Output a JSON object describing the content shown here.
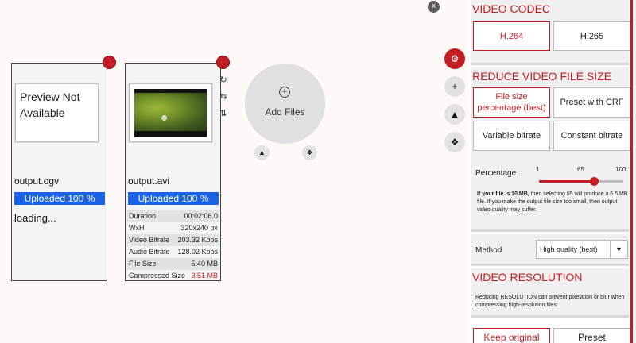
{
  "close_label": "x",
  "files": [
    {
      "preview_text": "Preview Not Available",
      "name": "output.ogv",
      "progress": "Uploaded 100 %",
      "progress_fraction": 1.0,
      "status": "loading..."
    },
    {
      "name": "output.avi",
      "progress": "Uploaded 100 %",
      "progress_fraction": 1.0,
      "stats": [
        {
          "k": "Duration",
          "v": "00:02:06.0"
        },
        {
          "k": "WxH",
          "v": "320x240 px"
        },
        {
          "k": "Video Bitrate",
          "v": "203.32 Kbps"
        },
        {
          "k": "Audio Bitrate",
          "v": "128.02 Kbps"
        },
        {
          "k": "File Size",
          "v": "5.40 MB"
        },
        {
          "k": "Compressed Size",
          "v": "3.51 MB"
        }
      ]
    }
  ],
  "add_files": {
    "label": "Add Files",
    "plus": "+"
  },
  "icons": {
    "rotate": "↻",
    "swap": "⇆",
    "updown": "⇅",
    "drive": "▲",
    "dropbox": "❖",
    "settings": "⚙",
    "plus": "+"
  },
  "panel": {
    "codec": {
      "title": "VIDEO CODEC",
      "options": [
        "H.264",
        "H.265"
      ],
      "selected": "H.264"
    },
    "reduce": {
      "title": "REDUCE VIDEO FILE SIZE",
      "options": [
        "File size percentage (best)",
        "Preset with CRF",
        "Variable bitrate",
        "Constant bitrate"
      ],
      "selected": "File size percentage (best)",
      "percentage_label": "Percentage",
      "min": "1",
      "value_label": "65",
      "max": "100",
      "value": 65,
      "note_bold": "If your file is 10 MB,",
      "note_rest": " then selecting 65 will produce a 6.5 MB file. If you make the output file size too small, then output video quality may suffer."
    },
    "method": {
      "label": "Method",
      "value": "High quality (best)",
      "arrow": "▼"
    },
    "resolution": {
      "title": "VIDEO RESOLUTION",
      "text": "Reducing RESOLUTION can prevent pixelation or blur when compressing high-resolution files.",
      "options": [
        "Keep original",
        "Preset"
      ]
    }
  },
  "colors": {
    "accent": "#c41e24",
    "progress": "#1a63e6"
  }
}
